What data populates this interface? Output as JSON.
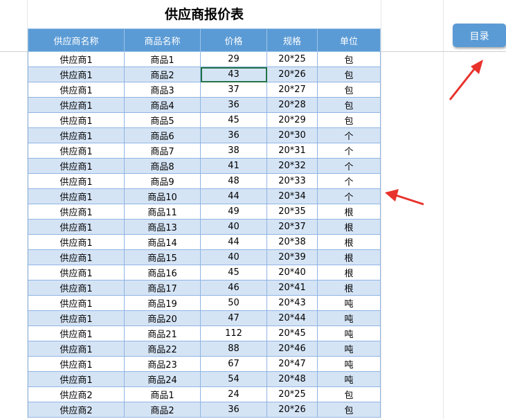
{
  "title": "供应商报价表",
  "menu_button": {
    "label": "目录"
  },
  "colors": {
    "header": "#5b9bd5",
    "band": "#d5e4f5",
    "arrow": "#e8322c",
    "selection": "#217346"
  },
  "table": {
    "headers": [
      "供应商名称",
      "商品名称",
      "价格",
      "规格",
      "单位"
    ],
    "rows": [
      [
        "供应商1",
        "商品1",
        "29",
        "20*25",
        "包"
      ],
      [
        "供应商1",
        "商品2",
        "43",
        "20*26",
        "包"
      ],
      [
        "供应商1",
        "商品3",
        "37",
        "20*27",
        "包"
      ],
      [
        "供应商1",
        "商品4",
        "36",
        "20*28",
        "包"
      ],
      [
        "供应商1",
        "商品5",
        "45",
        "20*29",
        "包"
      ],
      [
        "供应商1",
        "商品6",
        "36",
        "20*30",
        "个"
      ],
      [
        "供应商1",
        "商品7",
        "38",
        "20*31",
        "个"
      ],
      [
        "供应商1",
        "商品8",
        "41",
        "20*32",
        "个"
      ],
      [
        "供应商1",
        "商品9",
        "48",
        "20*33",
        "个"
      ],
      [
        "供应商1",
        "商品10",
        "44",
        "20*34",
        "个"
      ],
      [
        "供应商1",
        "商品11",
        "49",
        "20*35",
        "根"
      ],
      [
        "供应商1",
        "商品13",
        "40",
        "20*37",
        "根"
      ],
      [
        "供应商1",
        "商品14",
        "44",
        "20*38",
        "根"
      ],
      [
        "供应商1",
        "商品15",
        "40",
        "20*39",
        "根"
      ],
      [
        "供应商1",
        "商品16",
        "45",
        "20*40",
        "根"
      ],
      [
        "供应商1",
        "商品17",
        "46",
        "20*41",
        "根"
      ],
      [
        "供应商1",
        "商品19",
        "50",
        "20*43",
        "吨"
      ],
      [
        "供应商1",
        "商品20",
        "47",
        "20*44",
        "吨"
      ],
      [
        "供应商1",
        "商品21",
        "112",
        "20*45",
        "吨"
      ],
      [
        "供应商1",
        "商品22",
        "88",
        "20*46",
        "吨"
      ],
      [
        "供应商1",
        "商品23",
        "67",
        "20*47",
        "吨"
      ],
      [
        "供应商1",
        "商品24",
        "54",
        "20*48",
        "吨"
      ],
      [
        "供应商2",
        "商品1",
        "24",
        "20*25",
        "包"
      ],
      [
        "供应商2",
        "商品2",
        "36",
        "20*26",
        "包"
      ]
    ],
    "selected_cell": {
      "row": 1,
      "col": 2
    }
  }
}
